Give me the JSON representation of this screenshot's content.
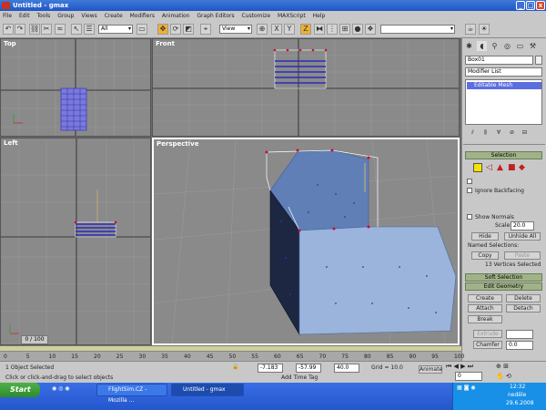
{
  "window": {
    "title": "Untitled - gmax",
    "minimize": "_",
    "maximize": "□",
    "close": "x"
  },
  "menu": [
    "File",
    "Edit",
    "Tools",
    "Group",
    "Views",
    "Create",
    "Modifiers",
    "Animation",
    "Graph Editors",
    "Customize",
    "MAXScript",
    "Help"
  ],
  "toolbar": {
    "selection_filter": "All",
    "ref_coord": "View"
  },
  "viewports": {
    "top": "Top",
    "front": "Front",
    "left": "Left",
    "perspective": "Perspective"
  },
  "command_panel": {
    "object_name": "Box01",
    "modifier_list": "Modifier List",
    "stack_item": "Editable Mesh",
    "selection_header": "Selection",
    "ignore_backfacing": "Ignore Backfacing",
    "show_normals": "Show Normals",
    "scale_label": "Scale:",
    "scale_value": "20.0",
    "hide": "Hide",
    "unhide_all": "Unhide All",
    "named_selections": "Named Selections:",
    "copy": "Copy",
    "paste": "Paste",
    "vertices_selected": "13 Vertices Selected",
    "soft_selection": "Soft Selection",
    "edit_geometry": "Edit Geometry",
    "create": "Create",
    "delete": "Delete",
    "attach": "Attach",
    "detach": "Detach",
    "break": "Break",
    "extrude": "Extrude",
    "chamfer": "Chamfer",
    "chamfer_value": "0.0"
  },
  "timeline": {
    "frame": "0 / 100",
    "ticks": [
      "0",
      "5",
      "10",
      "15",
      "20",
      "25",
      "30",
      "35",
      "40",
      "45",
      "50",
      "55",
      "60",
      "65",
      "70",
      "75",
      "80",
      "85",
      "90",
      "95",
      "100"
    ]
  },
  "status": {
    "selected": "1 Object Selected",
    "prompt": "Click or click-and-drag to select objects",
    "x": "-7.183",
    "y": "-57.99",
    "z": "40.0",
    "grid": "Grid = 10.0",
    "add_time_tag": "Add Time Tag",
    "animate": "Animate",
    "frame_field": "0"
  },
  "taskbar": {
    "start": "Start",
    "tasks": [
      "FlightSim.CZ - Mozilla ...",
      "Untitled - gmax"
    ],
    "time": "12:32",
    "day": "neděle",
    "date": "29.6.2008"
  }
}
